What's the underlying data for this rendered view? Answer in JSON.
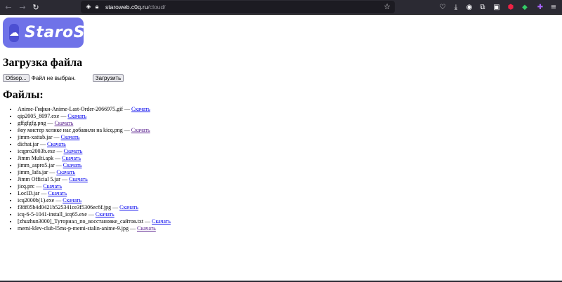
{
  "browser": {
    "url_host": "staroweb.c0q.ru",
    "url_path": "/cloud/"
  },
  "logo": {
    "text": "StaroS"
  },
  "upload": {
    "heading": "Загрузка файла",
    "browse_label": "Обзор...",
    "no_file_text": "Файл не выбран.",
    "submit_label": "Загрузить"
  },
  "files": {
    "heading": "Файлы:",
    "download_label": "Скачать",
    "items": [
      {
        "name": "Anime-Гифки-Anime-Last-Order-2066975.gif",
        "visited": false
      },
      {
        "name": "qip2005_8097.exe",
        "visited": false
      },
      {
        "name": "gffgfgfg.png",
        "visited": true
      },
      {
        "name": "йоу мистер хелике нас добавили на kicq.png",
        "visited": true
      },
      {
        "name": "jimm-xattab.jar",
        "visited": false
      },
      {
        "name": "dichat.jar",
        "visited": false
      },
      {
        "name": "icqpro2003b.exe",
        "visited": false
      },
      {
        "name": "Jimm Multi.apk",
        "visited": false
      },
      {
        "name": "jimm_aspro5.jar",
        "visited": false
      },
      {
        "name": "jimm_lafa.jar",
        "visited": false
      },
      {
        "name": "Jimm Official 5.jar",
        "visited": false
      },
      {
        "name": "jicq.prc",
        "visited": false
      },
      {
        "name": "LocID.jar",
        "visited": false
      },
      {
        "name": "icq2000b(1).exe",
        "visited": false
      },
      {
        "name": "f38f05b4d0421b525341ce3f5306ec6f.jpg",
        "visited": false
      },
      {
        "name": "icq-6-5-1041-install_icq65.exe",
        "visited": false
      },
      {
        "name": "[zhuzhun3000]_Туториал_по_восстановке_сайтов.txt",
        "visited": false
      },
      {
        "name": "memi-klev-club-l5ms-p-memi-stalin-anime-9.jpg",
        "visited": true
      }
    ]
  }
}
